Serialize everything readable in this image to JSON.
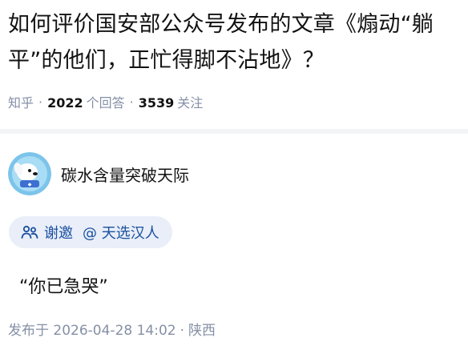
{
  "question": {
    "title": "如何评价国安部公众号发布的文章《煽动“躺平”的他们，正忙得脚不沾地》？",
    "meta": {
      "source": "知乎",
      "answer_count": "2022",
      "answer_unit": "个回答",
      "follower_count": "3539",
      "follower_unit": "关注"
    }
  },
  "author": {
    "name": "碳水含量突破天际",
    "avatar_icon": "dog-avatar-icon"
  },
  "invite": {
    "label": "谢邀",
    "mention": "@ 天选汉人",
    "icon": "invite-people-icon"
  },
  "answer": {
    "text": "“你已急哭”"
  },
  "publish": {
    "label": "发布于 2026-04-28 14:02",
    "location": "陕西"
  },
  "colors": {
    "muted": "#8590a6",
    "chip_bg": "#e9eef8",
    "chip_text": "#1a4fa0"
  }
}
